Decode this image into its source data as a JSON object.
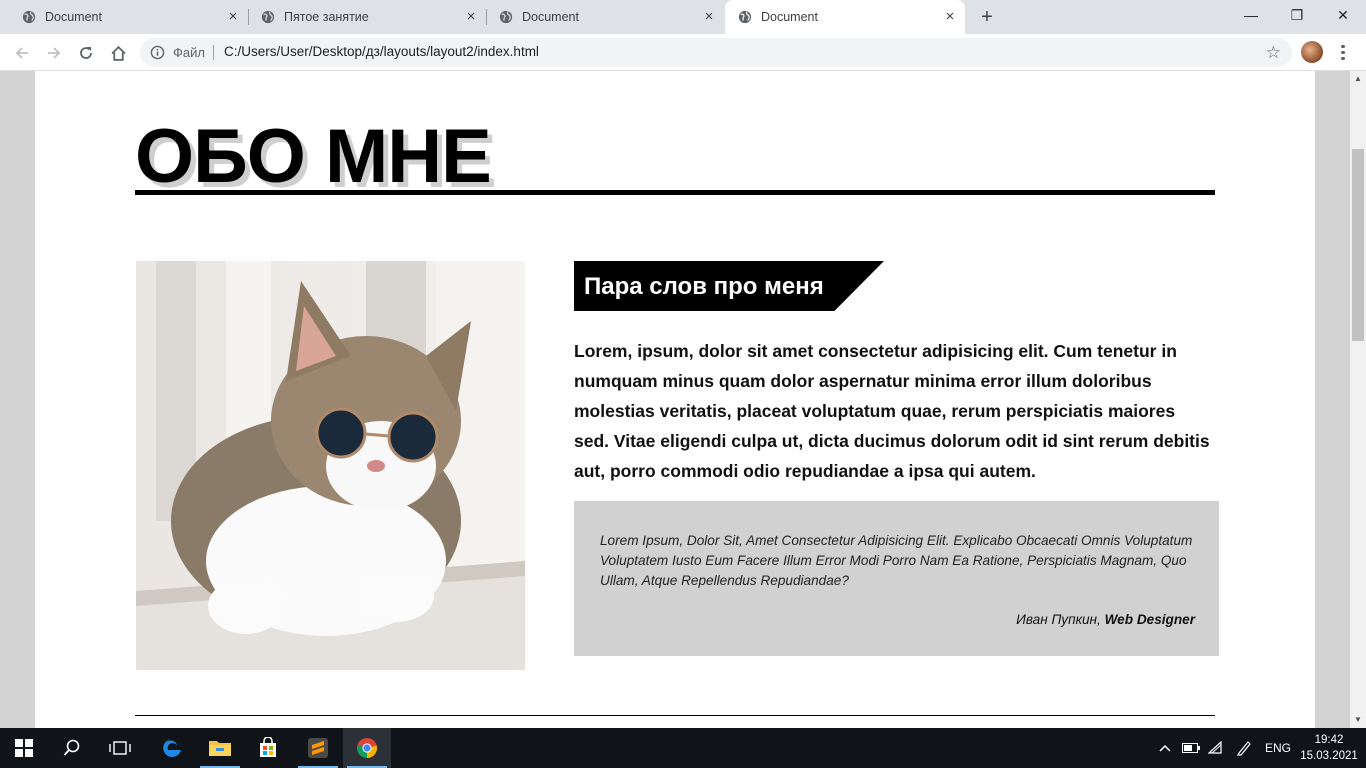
{
  "browser": {
    "tabs": [
      {
        "title": "Document",
        "active": false
      },
      {
        "title": "Пятое занятие",
        "active": false
      },
      {
        "title": "Document",
        "active": false
      },
      {
        "title": "Document",
        "active": true
      }
    ],
    "new_tab_symbol": "+",
    "window_controls": {
      "minimize": "—",
      "restore": "❐",
      "close": "✕"
    },
    "address": {
      "scheme_label": "Файл",
      "url": "C:/Users/User/Desktop/дз/layouts/layout2/index.html"
    },
    "icons": {
      "back": "arrow-left-icon",
      "forward": "arrow-right-icon",
      "reload": "reload-icon",
      "home": "home-icon",
      "bookmark": "star-icon",
      "menu": "kebab-icon"
    }
  },
  "page": {
    "title": "ОБО МНЕ",
    "photo_alt": "cat-with-sunglasses",
    "section_heading": "Пара слов про меня",
    "lead_text": "Lorem, ipsum, dolor sit amet consectetur adipisicing elit. Cum tenetur in numquam minus quam dolor aspernatur minima error illum doloribus molestias veritatis, placeat voluptatum quae, rerum perspiciatis maiores sed. Vitae eligendi culpa ut, dicta ducimus dolorum odit id sint rerum debitis aut, porro commodi odio repudiandae a ipsa qui autem.",
    "quote": {
      "text": "Lorem Ipsum, Dolor Sit, Amet Consectetur Adipisicing Elit. Explicabo Obcaecati Omnis Voluptatum Voluptatem Iusto Eum Facere Illum Error Modi Porro Nam Ea Ratione, Perspiciatis Magnam, Quo Ullam, Atque Repellendus Repudiandae?",
      "author_name": "Иван Пупкин,",
      "author_role": "Web Designer"
    },
    "colors": {
      "background_gutter": "#d3d3d3",
      "heading_bg": "#000000",
      "quote_bg": "#d1d1d1",
      "title_shadow": "#cfcfcf"
    }
  },
  "taskbar": {
    "apps": [
      "start-icon",
      "search-icon",
      "task-view-icon",
      "edge-icon",
      "file-explorer-icon",
      "store-icon",
      "sublime-text-icon",
      "chrome-icon"
    ],
    "tray": {
      "language": "ENG",
      "time": "19:42",
      "date": "15.03.2021"
    }
  }
}
